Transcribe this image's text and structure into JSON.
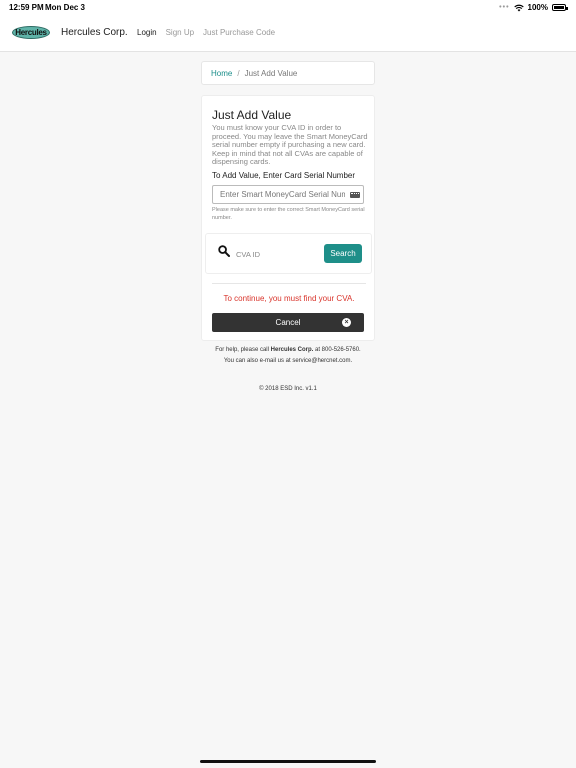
{
  "status_bar": {
    "time": "12:59 PM",
    "date": "Mon Dec 3",
    "battery": "100%"
  },
  "navbar": {
    "logo_text": "Hercules",
    "brand": "Hercules Corp.",
    "links": [
      {
        "label": "Login",
        "active": true
      },
      {
        "label": "Sign Up",
        "active": false
      },
      {
        "label": "Just Purchase Code",
        "active": false
      }
    ]
  },
  "breadcrumb": {
    "home": "Home",
    "separator": "/",
    "current": "Just Add Value"
  },
  "card": {
    "title": "Just Add Value",
    "description": "You must know your CVA ID in order to proceed. You may leave the Smart MoneyCard serial number empty if purchasing a new card. Keep in mind that not all CVAs are capable of dispensing cards.",
    "serial_label": "To Add Value, Enter Card Serial Number",
    "serial_placeholder": "Enter Smart MoneyCard Serial Number",
    "serial_hint": "Please make sure to enter the correct Smart MoneyCard serial number.",
    "cva_placeholder": "CVA ID",
    "search_label": "Search",
    "warning": "To continue, you must find your CVA.",
    "cancel_label": "Cancel"
  },
  "footer": {
    "help_prefix": "For help, please call",
    "help_company": "Hercules Corp.",
    "help_suffix": "at 800-526-5760.",
    "email_line": "You can also e-mail us at service@hercnet.com.",
    "copyright": "© 2018 ESD Inc. v1.1"
  },
  "colors": {
    "accent": "#1e8f89",
    "link": "#1a8e8a",
    "warning": "#d9342b",
    "dark_button": "#333333"
  }
}
